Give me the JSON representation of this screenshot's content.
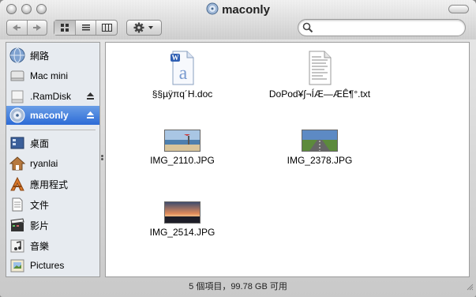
{
  "window": {
    "title": "maconly"
  },
  "search": {
    "value": "",
    "placeholder": ""
  },
  "sidebar": {
    "devices": [
      {
        "label": "網路",
        "icon": "network-globe-icon"
      },
      {
        "label": "Mac mini",
        "icon": "computer-icon"
      },
      {
        "label": ".RamDisk",
        "icon": "disk-icon",
        "ejectable": true
      },
      {
        "label": "maconly",
        "icon": "network-disk-icon",
        "ejectable": true,
        "selected": true
      }
    ],
    "places": [
      {
        "label": "桌面",
        "icon": "desktop-icon"
      },
      {
        "label": "ryanlai",
        "icon": "home-icon"
      },
      {
        "label": "應用程式",
        "icon": "applications-icon"
      },
      {
        "label": "文件",
        "icon": "documents-icon"
      },
      {
        "label": "影片",
        "icon": "movies-icon"
      },
      {
        "label": "音樂",
        "icon": "music-icon"
      },
      {
        "label": "Pictures",
        "icon": "pictures-icon"
      }
    ]
  },
  "files": [
    {
      "name": "§§µÿπq´H.doc",
      "icon": "word-document-icon"
    },
    {
      "name": "DoPod¥∫¬ÍÆ—ÆÊ¶°.txt",
      "icon": "text-file-icon"
    },
    {
      "name": "IMG_2110.JPG",
      "icon": "beach-photo-thumbnail"
    },
    {
      "name": "IMG_2378.JPG",
      "icon": "road-photo-thumbnail"
    },
    {
      "name": "IMG_2514.JPG",
      "icon": "sunset-photo-thumbnail"
    }
  ],
  "status": {
    "text": "5 個項目，99.78 GB 可用"
  },
  "colors": {
    "selection": "#2c6bd6",
    "sidebar_bg": "#e7ebf0"
  }
}
